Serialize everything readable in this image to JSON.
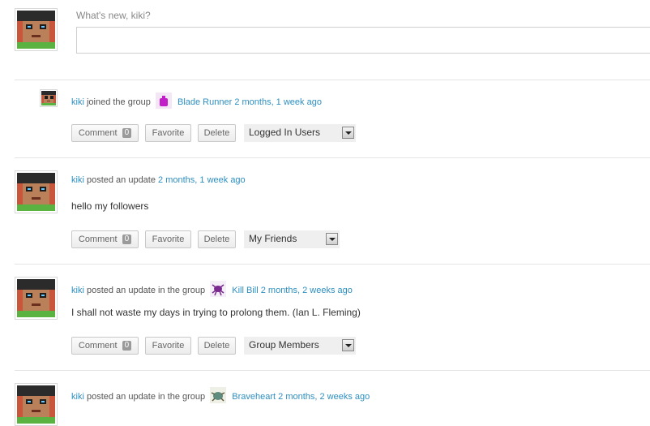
{
  "composer": {
    "placeholder": "What's new, kiki?"
  },
  "activity": [
    {
      "user": "kiki",
      "action": "joined the group",
      "group": "Blade Runner",
      "time": "2 months, 1 week ago",
      "group_icon": "purple-bag-icon",
      "comment_label": "Comment",
      "comment_count": "0",
      "favorite_label": "Favorite",
      "delete_label": "Delete",
      "visibility": "Logged In Users"
    },
    {
      "user": "kiki",
      "action": "posted an update",
      "time": "2 months, 1 week ago",
      "content": "hello my followers",
      "comment_label": "Comment",
      "comment_count": "0",
      "favorite_label": "Favorite",
      "delete_label": "Delete",
      "visibility": "My Friends"
    },
    {
      "user": "kiki",
      "action": "posted an update in the group",
      "group": "Kill Bill",
      "time": "2 months, 2 weeks ago",
      "group_icon": "purple-bug-icon",
      "content": "I shall not waste my days in trying to prolong them. (Ian L. Fleming)",
      "comment_label": "Comment",
      "comment_count": "0",
      "favorite_label": "Favorite",
      "delete_label": "Delete",
      "visibility": "Group Members"
    },
    {
      "user": "kiki",
      "action": "posted an update in the group",
      "group": "Braveheart",
      "time": "2 months, 2 weeks ago",
      "group_icon": "green-beetle-icon"
    }
  ],
  "colors": {
    "link": "#2e8fc0",
    "avatar_bg": "#c9553a",
    "button_count_bg": "#9a9a9a"
  }
}
